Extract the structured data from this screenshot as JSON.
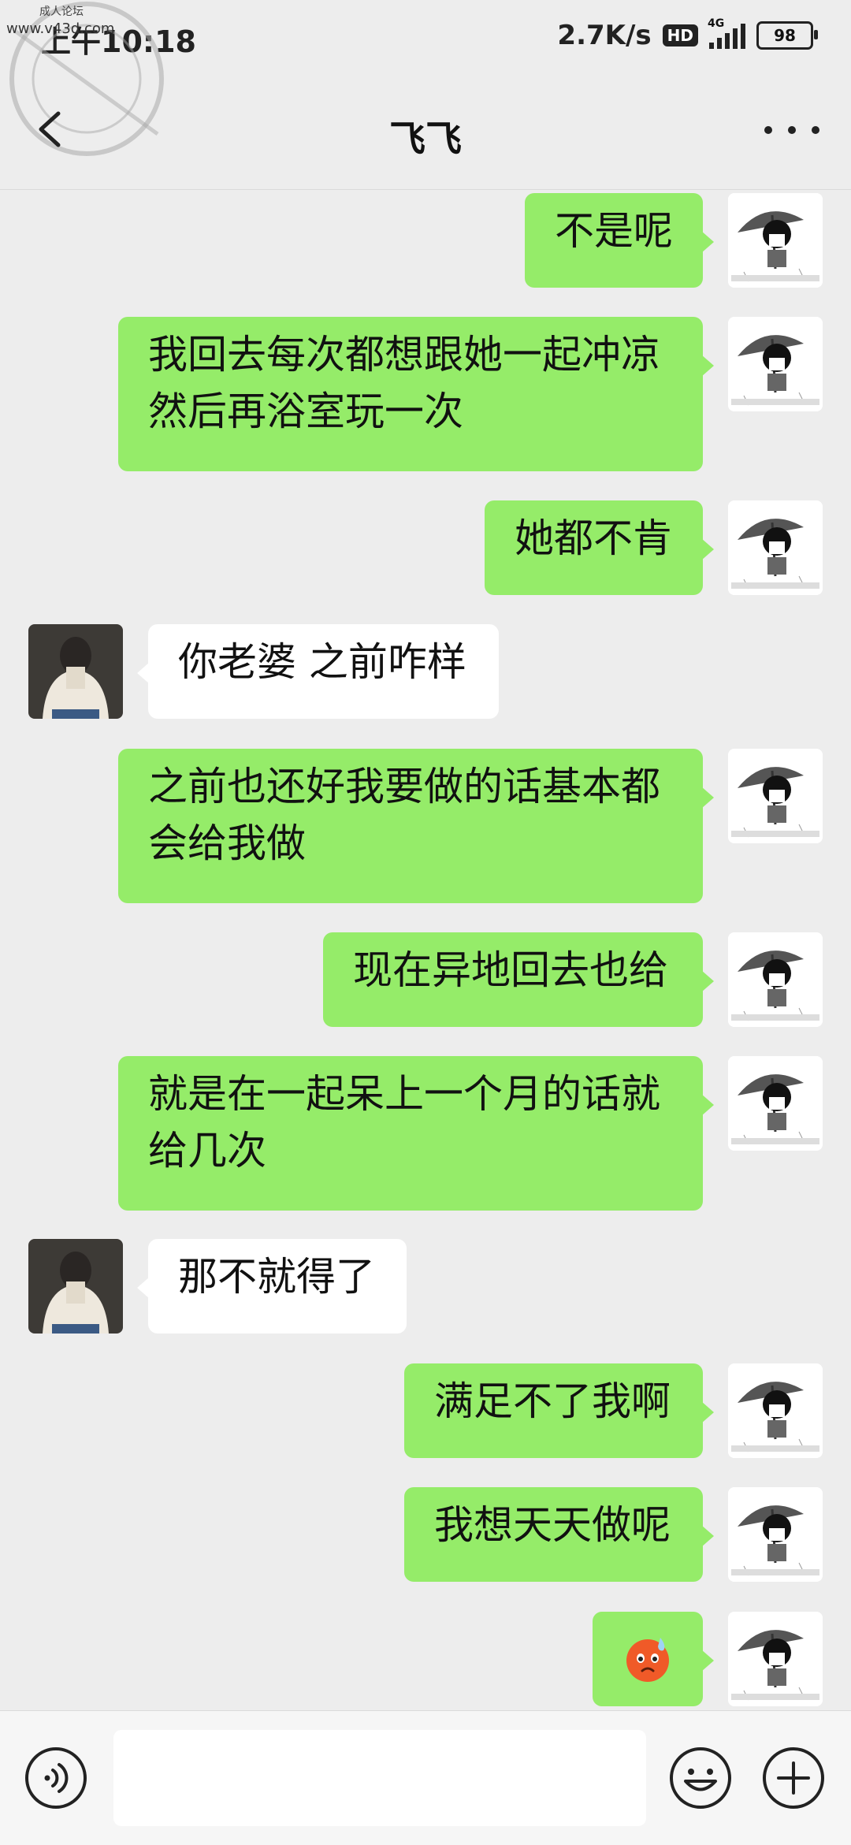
{
  "status_bar": {
    "time": "上午10:18",
    "net_speed": "2.7K/s",
    "hd_badge": "HD",
    "network": "4G",
    "battery": "98"
  },
  "watermark": {
    "small": "成人论坛",
    "site": "www.v43d.com"
  },
  "header": {
    "title": "飞飞"
  },
  "messages": [
    {
      "side": "me",
      "text": "不是呢"
    },
    {
      "side": "me",
      "text": "我回去每次都想跟她一起冲凉然后再浴室玩一次"
    },
    {
      "side": "me",
      "text": "她都不肯"
    },
    {
      "side": "other",
      "text": "你老婆 之前咋样"
    },
    {
      "side": "me",
      "text": "之前也还好我要做的话基本都会给我做"
    },
    {
      "side": "me",
      "text": "现在异地回去也给"
    },
    {
      "side": "me",
      "text": "就是在一起呆上一个月的话就给几次"
    },
    {
      "side": "other",
      "text": "那不就得了"
    },
    {
      "side": "me",
      "text": "满足不了我啊"
    },
    {
      "side": "me",
      "text": "我想天天做呢"
    },
    {
      "side": "me",
      "emoji": "sweat-face-emoji"
    }
  ],
  "input": {
    "value": "",
    "placeholder": ""
  },
  "icons": {
    "back": "back-arrow-icon",
    "more": "more-dots-icon",
    "voice": "voice-icon",
    "emoji": "emoji-icon",
    "plus": "plus-icon"
  }
}
